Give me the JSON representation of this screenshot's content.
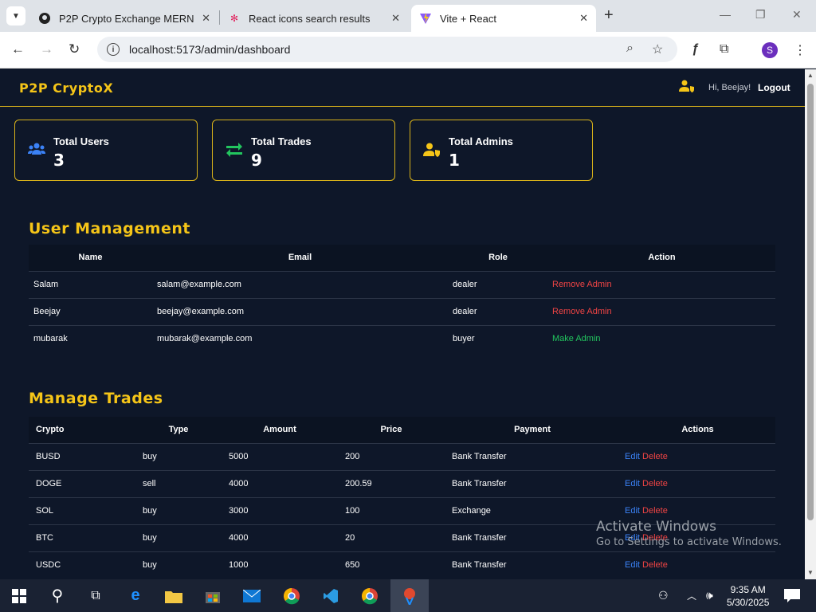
{
  "browser": {
    "tabs": [
      {
        "title": "P2P Crypto Exchange MERN",
        "icon": "github-icon"
      },
      {
        "title": "React icons search results",
        "icon": "react-icon"
      },
      {
        "title": "Vite + React",
        "icon": "vite-icon"
      }
    ],
    "url": "localhost:5173/admin/dashboard"
  },
  "app": {
    "brand": "P2P CryptoX",
    "greeting": "Hi, Beejay!",
    "logout": "Logout",
    "accent": "#f5c518"
  },
  "stats": [
    {
      "label": "Total Users",
      "value": "3",
      "icon": "users-icon",
      "color": "#3b82f6"
    },
    {
      "label": "Total Trades",
      "value": "9",
      "icon": "exchange-arrows-icon",
      "color": "#22c55e"
    },
    {
      "label": "Total Admins",
      "value": "1",
      "icon": "user-shield-icon",
      "color": "#f5c518"
    }
  ],
  "user_management": {
    "title": "User Management",
    "columns": [
      "Name",
      "Email",
      "Role",
      "Action"
    ],
    "rows": [
      {
        "name": "Salam",
        "email": "salam@example.com",
        "role": "dealer",
        "action": "Remove Admin"
      },
      {
        "name": "Beejay",
        "email": "beejay@example.com",
        "role": "dealer",
        "action": "Remove Admin"
      },
      {
        "name": "mubarak",
        "email": "mubarak@example.com",
        "role": "buyer",
        "action": "Make Admin"
      }
    ]
  },
  "trades": {
    "title": "Manage Trades",
    "columns": [
      "Crypto",
      "Type",
      "Amount",
      "Price",
      "Payment",
      "Actions"
    ],
    "edit_label": "Edit",
    "delete_label": "Delete",
    "rows": [
      {
        "crypto": "BUSD",
        "type": "buy",
        "amount": "5000",
        "price": "200",
        "payment": "Bank Transfer"
      },
      {
        "crypto": "DOGE",
        "type": "sell",
        "amount": "4000",
        "price": "200.59",
        "payment": "Bank Transfer"
      },
      {
        "crypto": "SOL",
        "type": "buy",
        "amount": "3000",
        "price": "100",
        "payment": "Exchange"
      },
      {
        "crypto": "BTC",
        "type": "buy",
        "amount": "4000",
        "price": "20",
        "payment": "Bank Transfer"
      },
      {
        "crypto": "USDC",
        "type": "buy",
        "amount": "1000",
        "price": "650",
        "payment": "Bank Transfer"
      }
    ]
  },
  "watermark": {
    "line1": "Activate Windows",
    "line2": "Go to Settings to activate Windows."
  },
  "taskbar": {
    "time": "9:35 AM",
    "date": "5/30/2025"
  }
}
